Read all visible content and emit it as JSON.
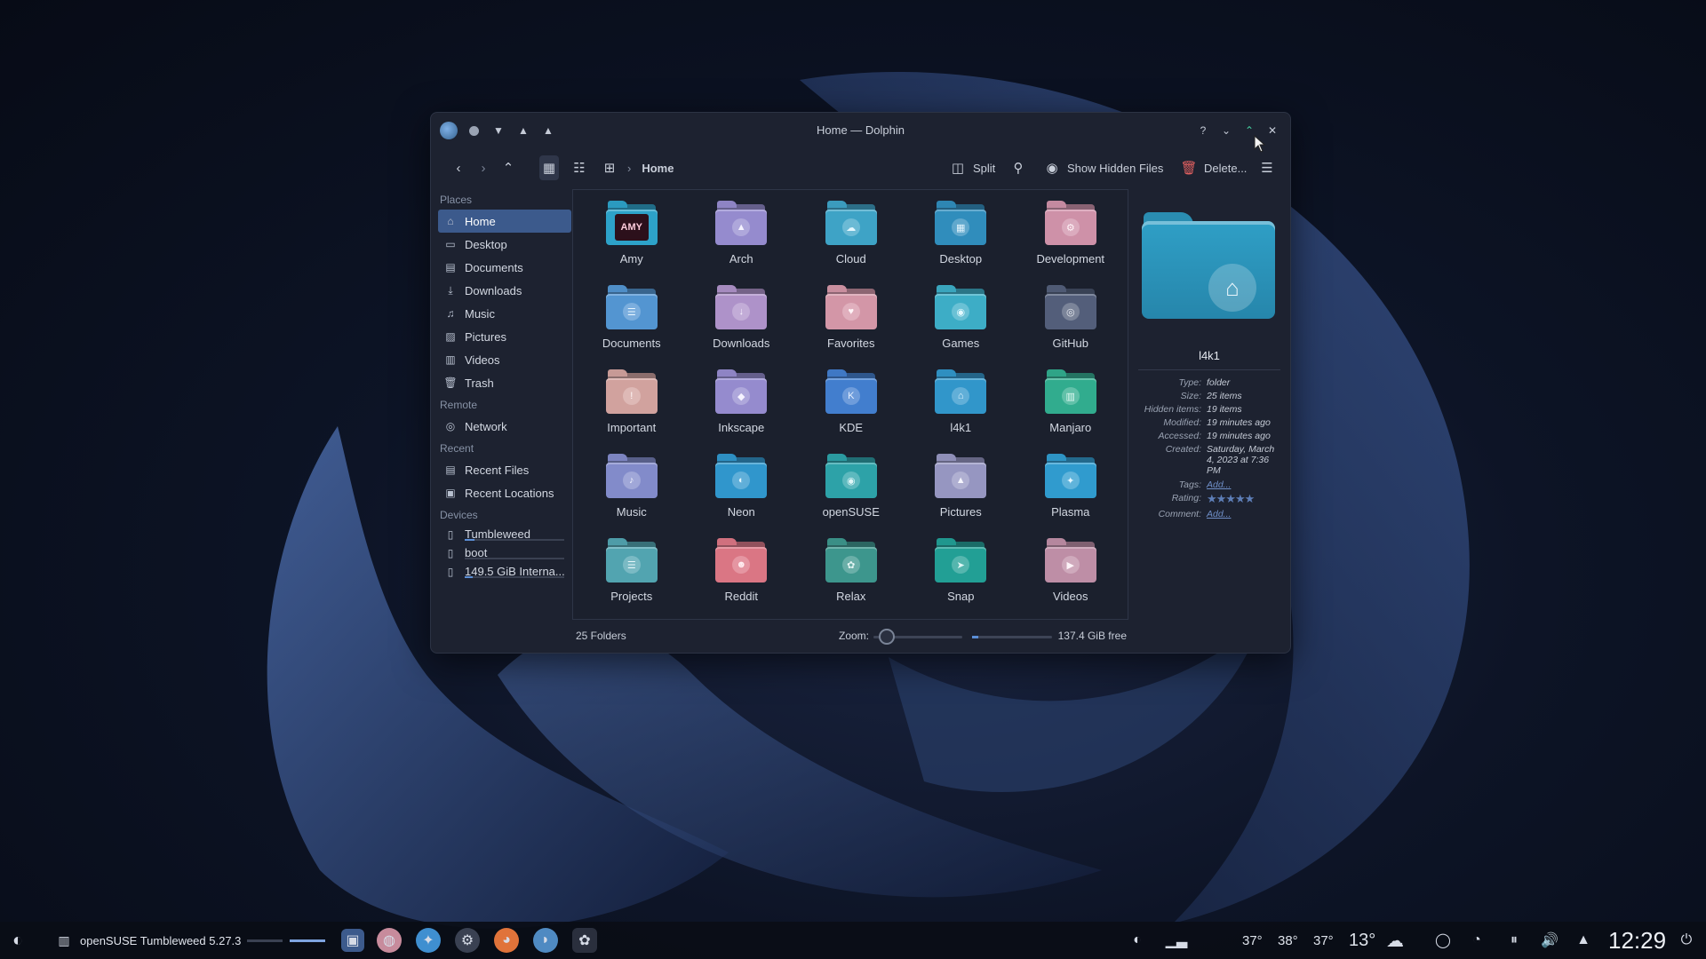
{
  "window": {
    "title": "Home — Dolphin",
    "buttons": {
      "help": "?",
      "minimize": "⌄",
      "maximize": "⌃",
      "close": "✕"
    }
  },
  "toolbar": {
    "breadcrumb": "Home",
    "split_label": "Split",
    "show_hidden_label": "Show Hidden Files",
    "delete_label": "Delete..."
  },
  "sidebar": {
    "sections": [
      {
        "title": "Places",
        "items": [
          {
            "label": "Home",
            "icon": "home-icon",
            "active": true
          },
          {
            "label": "Desktop",
            "icon": "desktop-icon"
          },
          {
            "label": "Documents",
            "icon": "documents-icon"
          },
          {
            "label": "Downloads",
            "icon": "download-icon"
          },
          {
            "label": "Music",
            "icon": "music-icon"
          },
          {
            "label": "Pictures",
            "icon": "pictures-icon"
          },
          {
            "label": "Videos",
            "icon": "videos-icon"
          },
          {
            "label": "Trash",
            "icon": "trash-icon"
          }
        ]
      },
      {
        "title": "Remote",
        "items": [
          {
            "label": "Network",
            "icon": "network-icon"
          }
        ]
      },
      {
        "title": "Recent",
        "items": [
          {
            "label": "Recent Files",
            "icon": "recent-files-icon"
          },
          {
            "label": "Recent Locations",
            "icon": "recent-locations-icon"
          }
        ]
      },
      {
        "title": "Devices",
        "items": [
          {
            "label": "Tumbleweed",
            "icon": "drive-icon",
            "usage": 0.1
          },
          {
            "label": "boot",
            "icon": "drive-icon",
            "usage": 0.0
          },
          {
            "label": "149.5 GiB Interna...",
            "icon": "drive-icon",
            "usage": 0.08
          }
        ]
      }
    ]
  },
  "folders": [
    {
      "name": "Amy",
      "color": "#2b9abf",
      "emblem": "AMY"
    },
    {
      "name": "Arch",
      "color": "#8e84c4",
      "emblem": "▲"
    },
    {
      "name": "Cloud",
      "color": "#3b9bbd",
      "emblem": "☁"
    },
    {
      "name": "Desktop",
      "color": "#2e86b3",
      "emblem": "▦"
    },
    {
      "name": "Development",
      "color": "#c48aa0",
      "emblem": "⚙"
    },
    {
      "name": "Documents",
      "color": "#4f8ec7",
      "emblem": "☰"
    },
    {
      "name": "Downloads",
      "color": "#a68bbf",
      "emblem": "↓"
    },
    {
      "name": "Favorites",
      "color": "#c98f9f",
      "emblem": "♥"
    },
    {
      "name": "Games",
      "color": "#3aa5bd",
      "emblem": "◉"
    },
    {
      "name": "GitHub",
      "color": "#4f5a74",
      "emblem": "◎"
    },
    {
      "name": "Important",
      "color": "#c79a96",
      "emblem": "!"
    },
    {
      "name": "Inkscape",
      "color": "#8e84c4",
      "emblem": "◆"
    },
    {
      "name": "KDE",
      "color": "#3f78c4",
      "emblem": "K"
    },
    {
      "name": "l4k1",
      "color": "#2f8fc0",
      "emblem": "⌂"
    },
    {
      "name": "Manjaro",
      "color": "#2fa487",
      "emblem": "▥"
    },
    {
      "name": "Music",
      "color": "#7c84c0",
      "emblem": "♪"
    },
    {
      "name": "Neon",
      "color": "#2e8fc2",
      "emblem": "◐"
    },
    {
      "name": "openSUSE",
      "color": "#2b9aa0",
      "emblem": "◉"
    },
    {
      "name": "Pictures",
      "color": "#8f8fb8",
      "emblem": "▲"
    },
    {
      "name": "Plasma",
      "color": "#2e94c4",
      "emblem": "✦"
    },
    {
      "name": "Projects",
      "color": "#4e9ca8",
      "emblem": "☰"
    },
    {
      "name": "Reddit",
      "color": "#d0707e",
      "emblem": "☻"
    },
    {
      "name": "Relax",
      "color": "#3a8f86",
      "emblem": "✿"
    },
    {
      "name": "Snap",
      "color": "#20978e",
      "emblem": "➤"
    },
    {
      "name": "Videos",
      "color": "#b5879e",
      "emblem": "▶"
    }
  ],
  "status": {
    "count": "25 Folders",
    "zoom_label": "Zoom:",
    "zoom_level": 0.1,
    "free_space": "137.4 GiB free",
    "used_fraction": 0.08
  },
  "info": {
    "name": "l4k1",
    "rows": [
      {
        "k": "Type:",
        "v": "folder"
      },
      {
        "k": "Size:",
        "v": "25 items"
      },
      {
        "k": "Hidden items:",
        "v": "19 items"
      },
      {
        "k": "Modified:",
        "v": "19 minutes ago"
      },
      {
        "k": "Accessed:",
        "v": "19 minutes ago"
      },
      {
        "k": "Created:",
        "v": "Saturday, March 4, 2023 at 7:36 PM"
      },
      {
        "k": "Tags:",
        "v": "Add...",
        "link": true
      },
      {
        "k": "Rating:",
        "v": "★★★★★",
        "stars": true
      },
      {
        "k": "Comment:",
        "v": "Add...",
        "link": true
      }
    ]
  },
  "taskbar": {
    "task_title": "openSUSE Tumbleweed 5.27.3",
    "temps": [
      "37°",
      "38°",
      "37°"
    ],
    "weather": "13°",
    "clock": "12:29"
  }
}
